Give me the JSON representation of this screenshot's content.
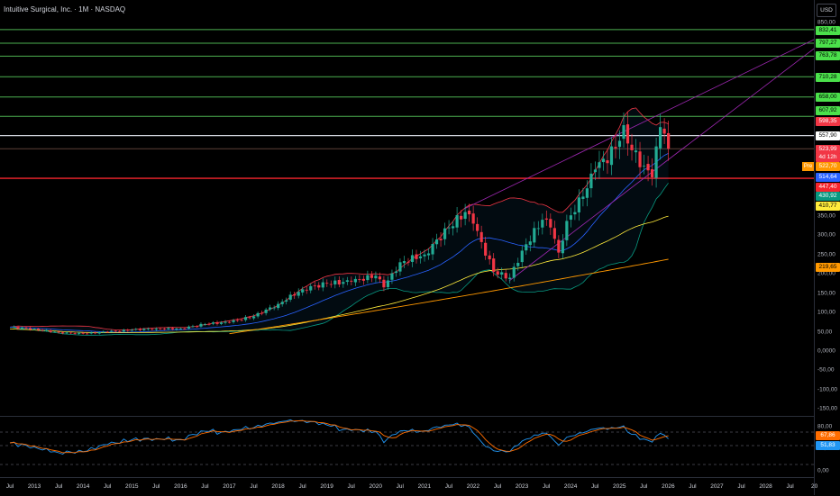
{
  "header": {
    "title": "Intuitive Surgical, Inc. · 1M · NASDAQ",
    "currency_button": "USD"
  },
  "colors": {
    "up": "#22ab94",
    "down": "#f23645",
    "green_level": "#4caf50",
    "white_level": "#d1d4dc",
    "red_level": "#f7252d",
    "trend": "#9c27b0"
  },
  "price_axis": {
    "ticks": [
      {
        "label": "850,00",
        "value": 850
      },
      {
        "label": "350,00",
        "value": 350
      },
      {
        "label": "300,00",
        "value": 300
      },
      {
        "label": "250,00",
        "value": 250
      },
      {
        "label": "200,00",
        "value": 200
      },
      {
        "label": "150,00",
        "value": 150
      },
      {
        "label": "100,00",
        "value": 100
      },
      {
        "label": "50,00",
        "value": 50
      },
      {
        "label": "0,0000",
        "value": 0
      },
      {
        "label": "-50,00",
        "value": -50
      },
      {
        "label": "-100,00",
        "value": -100
      },
      {
        "label": "-150,00",
        "value": -150
      }
    ],
    "labels": [
      {
        "text": "832,41",
        "bg": "#4be04b",
        "fg": "#000"
      },
      {
        "text": "797,27",
        "bg": "#4be04b",
        "fg": "#000"
      },
      {
        "text": "763,78",
        "bg": "#4be04b",
        "fg": "#000"
      },
      {
        "text": "710,28",
        "bg": "#4be04b",
        "fg": "#000"
      },
      {
        "text": "658,00",
        "bg": "#4be04b",
        "fg": "#000"
      },
      {
        "text": "607,92",
        "bg": "#4be04b",
        "fg": "#000"
      },
      {
        "text": "598,35",
        "bg": "#f23645",
        "fg": "#fff"
      },
      {
        "text": "557,90",
        "bg": "#ffffff",
        "fg": "#000"
      },
      {
        "text": "523,99",
        "bg": "#f23645",
        "fg": "#fff"
      },
      {
        "text": "4d 12h",
        "bg": "#f23645",
        "fg": "#fff"
      },
      {
        "text": "522,70",
        "bg": "#ff9800",
        "fg": "#fff"
      },
      {
        "text": "514,64",
        "bg": "#2962ff",
        "fg": "#fff"
      },
      {
        "text": "447,40",
        "bg": "#f7252d",
        "fg": "#fff"
      },
      {
        "text": "430,92",
        "bg": "#089981",
        "fg": "#fff"
      },
      {
        "text": "410,77",
        "bg": "#ffeb3b",
        "fg": "#000"
      },
      {
        "text": "219,65",
        "bg": "#ff9800",
        "fg": "#000"
      }
    ],
    "pre_badge": "Pre"
  },
  "rsi_axis": {
    "ticks": [
      {
        "label": "80,00",
        "value": 80
      },
      {
        "label": "40,00",
        "value": 40
      },
      {
        "label": "0,00",
        "value": 0
      }
    ],
    "labels": [
      {
        "text": "67,86",
        "bg": "#ff6d00",
        "fg": "#fff"
      },
      {
        "text": "51,83",
        "bg": "#2196f3",
        "fg": "#fff"
      }
    ]
  },
  "time_axis": [
    "Jul",
    "2013",
    "Jul",
    "2014",
    "Jul",
    "2015",
    "Jul",
    "2016",
    "Jul",
    "2017",
    "Jul",
    "2018",
    "Jul",
    "2019",
    "Jul",
    "2020",
    "Jul",
    "2021",
    "Jul",
    "2022",
    "Jul",
    "2023",
    "Jul",
    "2024",
    "Jul",
    "2025",
    "Jul",
    "2026",
    "Jul",
    "2027",
    "Jul",
    "2028",
    "Jul",
    "20"
  ],
  "chart_data": {
    "type": "candlestick",
    "interval": "1M",
    "start": "2012-07",
    "levels": [
      832.41,
      797.27,
      763.78,
      710.28,
      658.0,
      607.92,
      557.9,
      523.99,
      447.4
    ],
    "close_keyframes": [
      [
        0,
        62
      ],
      [
        6,
        57
      ],
      [
        12,
        48
      ],
      [
        18,
        45
      ],
      [
        24,
        50
      ],
      [
        30,
        55
      ],
      [
        36,
        58
      ],
      [
        42,
        58
      ],
      [
        48,
        70
      ],
      [
        54,
        75
      ],
      [
        60,
        90
      ],
      [
        66,
        122
      ],
      [
        72,
        160
      ],
      [
        78,
        175
      ],
      [
        84,
        180
      ],
      [
        90,
        195
      ],
      [
        92,
        165
      ],
      [
        96,
        230
      ],
      [
        102,
        250
      ],
      [
        108,
        320
      ],
      [
        112,
        360
      ],
      [
        114,
        330
      ],
      [
        119,
        205
      ],
      [
        123,
        190
      ],
      [
        126,
        260
      ],
      [
        131,
        340
      ],
      [
        133,
        320
      ],
      [
        135,
        255
      ],
      [
        137,
        337
      ],
      [
        141,
        400
      ],
      [
        144,
        470
      ],
      [
        149,
        525
      ],
      [
        151,
        585
      ],
      [
        153,
        520
      ],
      [
        156,
        480
      ],
      [
        158,
        450
      ],
      [
        159,
        530
      ],
      [
        160,
        580
      ],
      [
        161,
        563
      ],
      [
        162,
        524
      ]
    ]
  }
}
